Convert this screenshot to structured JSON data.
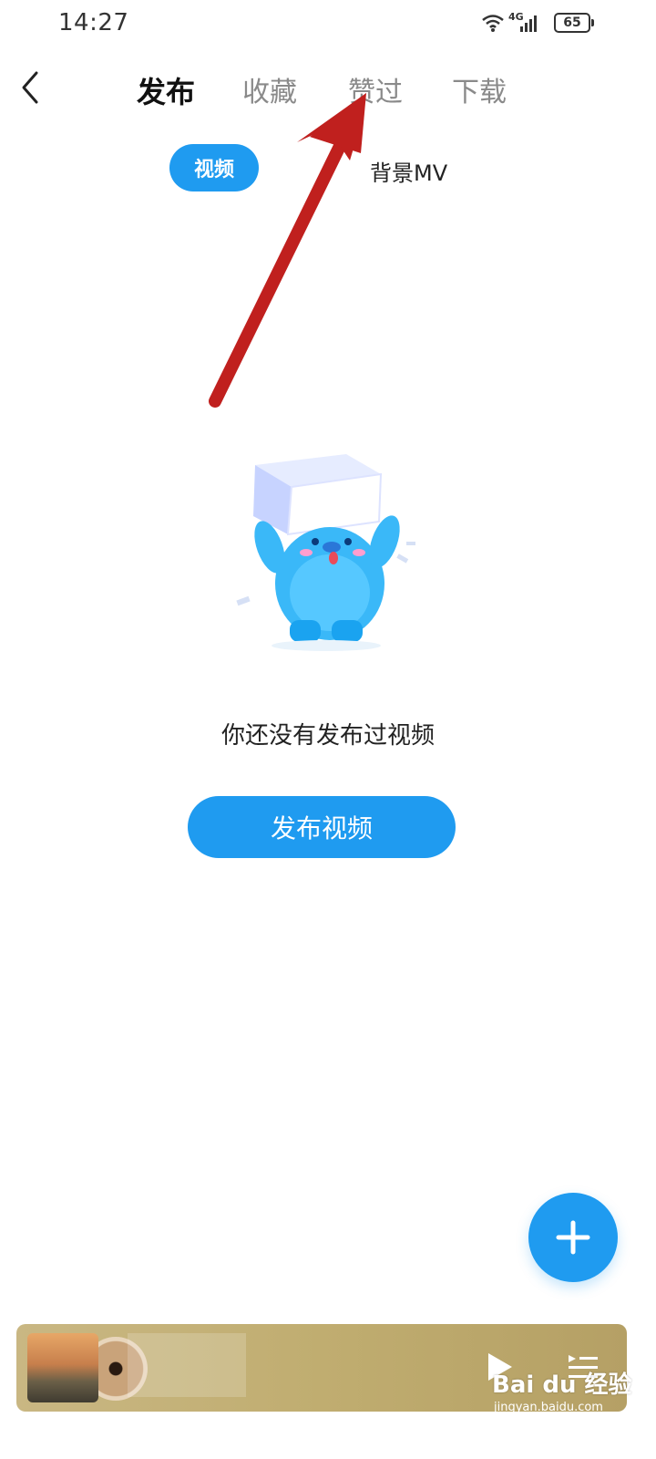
{
  "status_bar": {
    "time": "14:27",
    "network": "4G",
    "battery": "65",
    "icons": [
      "wifi-icon",
      "cellular-signal-icon",
      "battery-icon"
    ]
  },
  "header": {
    "back_icon": "chevron-left-icon",
    "tabs": [
      {
        "label": "发布",
        "active": true
      },
      {
        "label": "收藏",
        "active": false
      },
      {
        "label": "赞过",
        "active": false
      },
      {
        "label": "下载",
        "active": false
      }
    ]
  },
  "subtabs": [
    {
      "label": "视频",
      "active": true
    },
    {
      "label": "背景MV",
      "active": false
    }
  ],
  "empty_state": {
    "message": "你还没有发布过视频",
    "button_label": "发布视频",
    "illustration": "mascot-holding-box-illustration"
  },
  "fab": {
    "icon": "plus-icon"
  },
  "mini_player": {
    "cover": "album-cover-image",
    "play_icon": "play-icon",
    "playlist_icon": "playlist-icon"
  },
  "watermark": {
    "brand": "Bai du 经验",
    "url": "jingyan.baidu.com"
  },
  "colors": {
    "accent": "#1f9bf0",
    "annotation_arrow": "#c0201e",
    "player_bg": "#c2ae72"
  }
}
